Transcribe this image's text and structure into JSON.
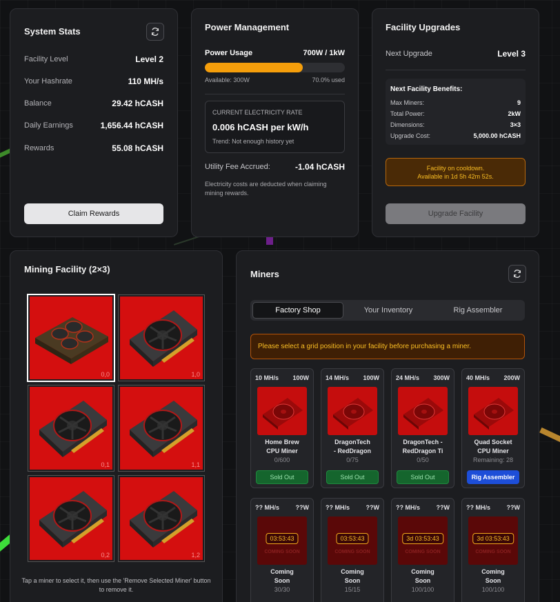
{
  "system_stats": {
    "title": "System Stats",
    "rows": [
      {
        "label": "Facility Level",
        "value": "Level 2"
      },
      {
        "label": "Your Hashrate",
        "value": "110 MH/s"
      },
      {
        "label": "Balance",
        "value": "29.42 hCASH"
      },
      {
        "label": "Daily Earnings",
        "value": "1,656.44 hCASH"
      },
      {
        "label": "Rewards",
        "value": "55.08 hCASH"
      }
    ],
    "claim_label": "Claim Rewards",
    "refresh_icon": "refresh-icon"
  },
  "power": {
    "title": "Power Management",
    "usage_label": "Power Usage",
    "usage_value": "700W / 1kW",
    "usage_fraction": 0.7,
    "available": "Available: 300W",
    "used_pct": "70.0% used",
    "rate_heading": "CURRENT ELECTRICITY RATE",
    "rate_value": "0.006 hCASH per kW/h",
    "trend": "Trend: Not enough history yet",
    "fee_label": "Utility Fee Accrued:",
    "fee_value": "-1.04 hCASH",
    "note": "Electricity costs are deducted when claiming mining rewards."
  },
  "upgrades": {
    "title": "Facility Upgrades",
    "next_label": "Next Upgrade",
    "next_value": "Level 3",
    "benefits_title": "Next Facility Benefits:",
    "benefits": [
      {
        "k": "Max Miners:",
        "v": "9"
      },
      {
        "k": "Total Power:",
        "v": "2kW"
      },
      {
        "k": "Dimensions:",
        "v": "3×3"
      },
      {
        "k": "Upgrade Cost:",
        "v": "5,000.00 hCASH"
      }
    ],
    "cooldown_line1": "Facility on cooldown.",
    "cooldown_line2": "Available in 1d 5h 42m 52s.",
    "upgrade_label": "Upgrade Facility"
  },
  "facility": {
    "title": "Mining Facility (2×3)",
    "cells": [
      {
        "idx": "0,0",
        "kind": "cpu"
      },
      {
        "idx": "1,0",
        "kind": "gpu"
      },
      {
        "idx": "0,1",
        "kind": "gpu"
      },
      {
        "idx": "1,1",
        "kind": "gpu"
      },
      {
        "idx": "0,2",
        "kind": "gpu"
      },
      {
        "idx": "1,2",
        "kind": "gpu"
      }
    ],
    "hint": "Tap a miner to select it, then use the 'Remove Selected Miner' button to remove it."
  },
  "miners": {
    "title": "Miners",
    "tabs": [
      "Factory Shop",
      "Your Inventory",
      "Rig Assembler"
    ],
    "alert": "Please select a grid position in your facility before purchasing a miner.",
    "items": [
      {
        "hash": "10 MH/s",
        "power": "100W",
        "name1": "Home Brew",
        "name2": "CPU Miner",
        "stock": "0/600",
        "btn": "Sold Out"
      },
      {
        "hash": "14 MH/s",
        "power": "100W",
        "name1": "DragonTech",
        "name2": "- RedDragon",
        "stock": "0/75",
        "btn": "Sold Out"
      },
      {
        "hash": "24 MH/s",
        "power": "300W",
        "name1": "DragonTech -",
        "name2": "RedDragon Ti",
        "stock": "0/50",
        "btn": "Sold Out"
      },
      {
        "hash": "40 MH/s",
        "power": "200W",
        "name1": "Quad Socket",
        "name2": "CPU Miner",
        "stock": "Remaining: 28",
        "btn": "Rig Assembler"
      }
    ],
    "soon_items": [
      {
        "hash": "?? MH/s",
        "power": "??W",
        "timer": "03:53:43",
        "soon_label": "COMING SOON",
        "name1": "Coming",
        "name2": "Soon",
        "stock": "30/30"
      },
      {
        "hash": "?? MH/s",
        "power": "??W",
        "timer": "03:53:43",
        "soon_label": "COMING SOON",
        "name1": "Coming",
        "name2": "Soon",
        "stock": "15/15"
      },
      {
        "hash": "?? MH/s",
        "power": "??W",
        "timer": "3d 03:53:43",
        "soon_label": "COMING SOON",
        "name1": "Coming",
        "name2": "Soon",
        "stock": "100/100"
      },
      {
        "hash": "?? MH/s",
        "power": "??W",
        "timer": "3d 03:53:43",
        "soon_label": "COMING SOON",
        "name1": "Coming",
        "name2": "Soon",
        "stock": "100/100"
      }
    ]
  },
  "colors": {
    "accent_orange": "#f59e0b",
    "tile_red": "#d40f0f",
    "sold_out_green": "#15652d",
    "rig_blue": "#1d4ed8"
  }
}
